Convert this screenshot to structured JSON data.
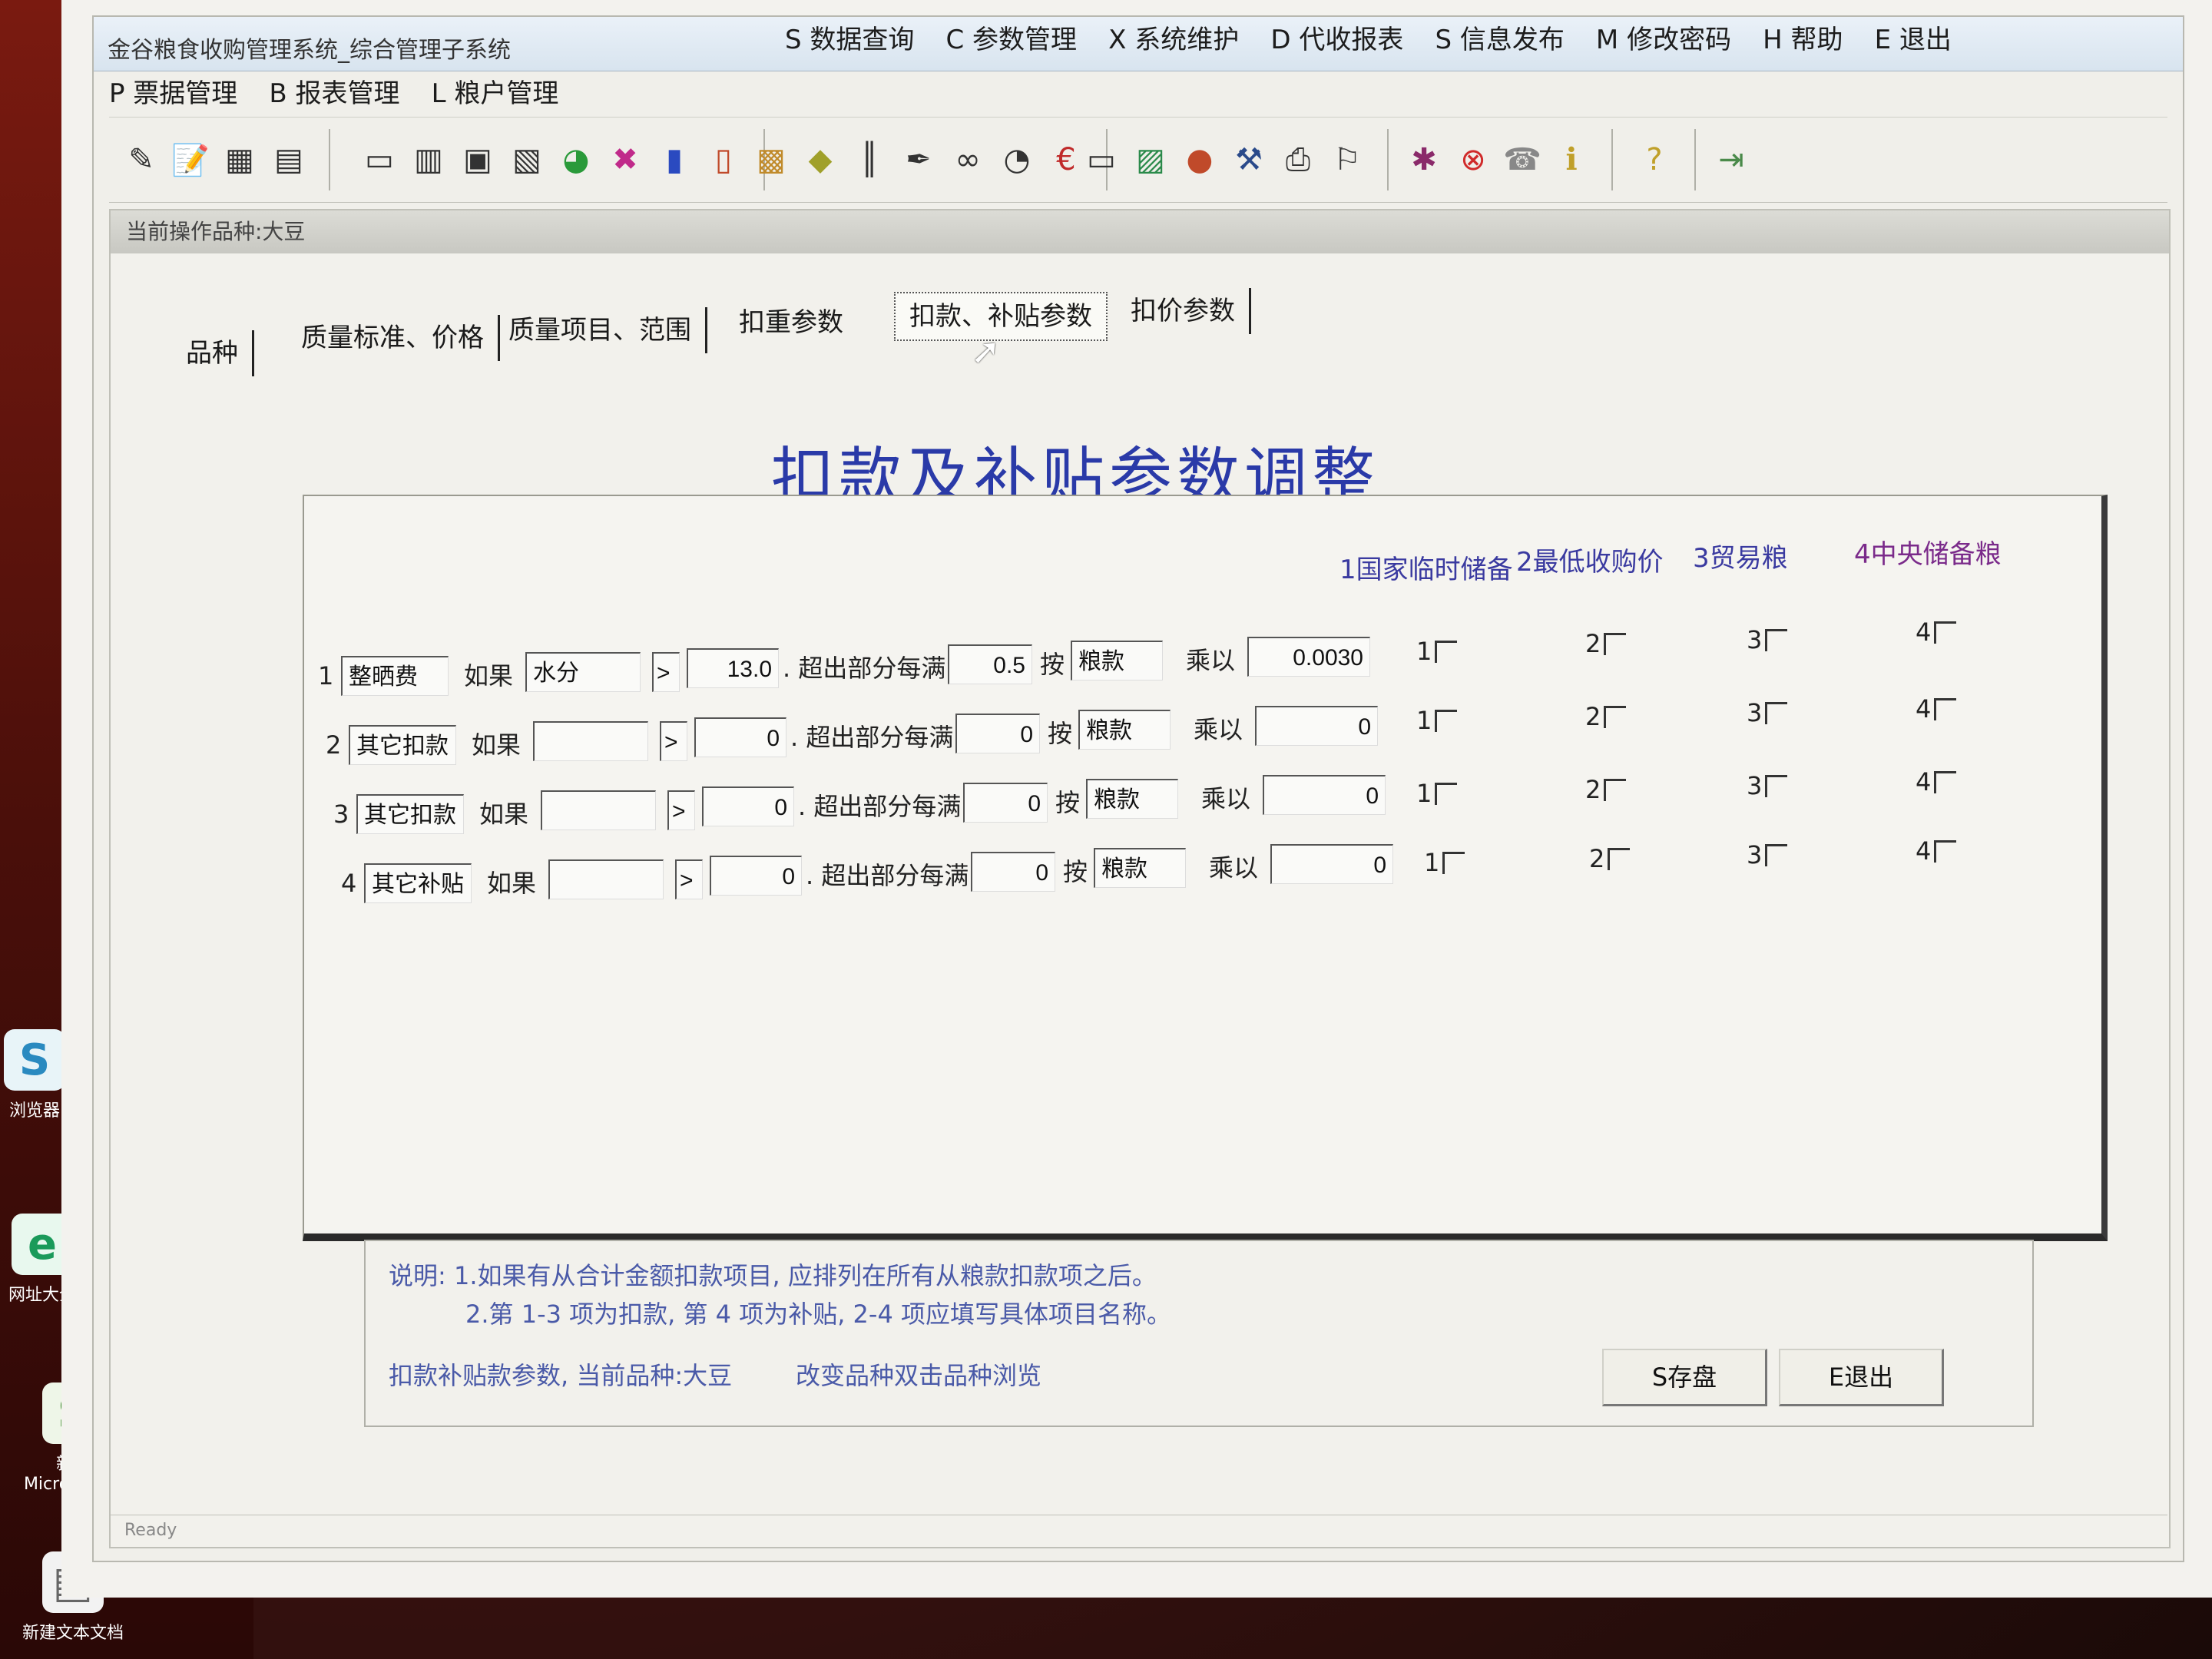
{
  "window": {
    "title": "金谷粮食收购管理系统_综合管理子系统"
  },
  "menu": {
    "items": [
      {
        "label": "P 票据管理"
      },
      {
        "label": "B 报表管理"
      },
      {
        "label": "L 粮户管理"
      },
      {
        "label": "S 数据查询"
      },
      {
        "label": "C 参数管理"
      },
      {
        "label": "X 系统维护"
      },
      {
        "label": "D 代收报表"
      },
      {
        "label": "S 信息发布"
      },
      {
        "label": "M 修改密码"
      },
      {
        "label": "H 帮助"
      },
      {
        "label": "E 退出"
      }
    ]
  },
  "subwindow": {
    "title": "当前操作品种:大豆"
  },
  "tabs": [
    {
      "label": "品种"
    },
    {
      "label": "质量标准、价格"
    },
    {
      "label": "质量项目、范围"
    },
    {
      "label": "扣重参数"
    },
    {
      "label": "扣款、补贴参数"
    },
    {
      "label": "扣价参数"
    }
  ],
  "panel": {
    "title": "扣款及补贴参数调整",
    "columns": [
      "1国家临时储备",
      "2最低收购价",
      "3贸易粮",
      "4中央储备粮"
    ],
    "if_label": "如果",
    "excess_label": ". 超出部分每满",
    "by_label": "按",
    "times_label": "乘以",
    "rows": [
      {
        "num": "1",
        "name": "整晒费",
        "item": "水分",
        "op": ">",
        "threshold": "13.0",
        "step": "0.5",
        "basis": "粮款",
        "factor": "0.0030"
      },
      {
        "num": "2",
        "name": "其它扣款",
        "item": "",
        "op": ">",
        "threshold": "0",
        "step": "0",
        "basis": "粮款",
        "factor": "0"
      },
      {
        "num": "3",
        "name": "其它扣款",
        "item": "",
        "op": ">",
        "threshold": "0",
        "step": "0",
        "basis": "粮款",
        "factor": "0"
      },
      {
        "num": "4",
        "name": "其它补贴",
        "item": "",
        "op": ">",
        "threshold": "0",
        "step": "0",
        "basis": "粮款",
        "factor": "0"
      }
    ],
    "check_labels": [
      "1",
      "2",
      "3",
      "4"
    ]
  },
  "notes": {
    "line1": "说明: 1.如果有从合计金额扣款项目, 应排列在所有从粮款扣款项之后。",
    "line2": "2.第 1-3 项为扣款, 第 4 项为补贴, 2-4 项应填写具体项目名称。",
    "status": "扣款补贴款参数, 当前品种:大豆",
    "hint": "改变品种双击品种浏览"
  },
  "buttons": {
    "save": "S存盘",
    "exit": "E退出"
  },
  "statusbar": {
    "text": "Ready"
  },
  "desktop": {
    "icons": [
      {
        "label": "浏览器"
      },
      {
        "label": "网址大全"
      },
      {
        "label": "新建 Microsoft ..."
      },
      {
        "label": "新建文本文档"
      }
    ]
  },
  "colors": {
    "title_blue": "#2a3aa8",
    "note_blue": "#4a5aa8",
    "purple": "#7a2a8a"
  }
}
